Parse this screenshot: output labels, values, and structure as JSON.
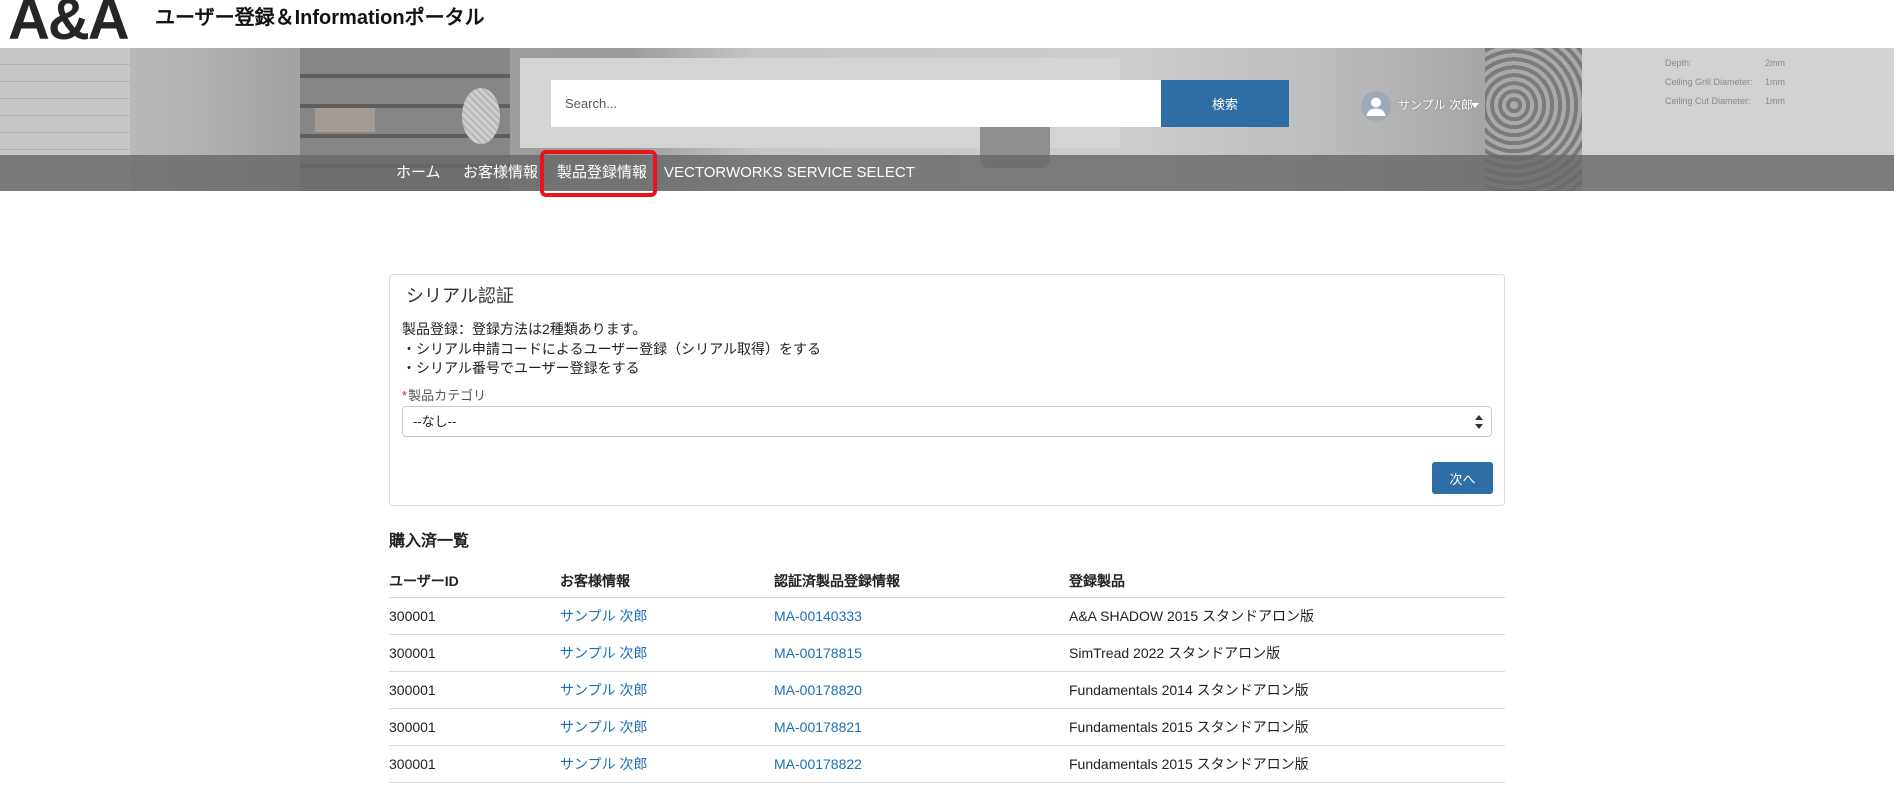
{
  "header": {
    "logo_text": "A&A",
    "portal_title": "ユーザー登録＆Informationポータル"
  },
  "search": {
    "placeholder": "Search...",
    "value": "",
    "button_label": "検索",
    "icon": "search-icon"
  },
  "user_menu": {
    "name": "サンプル 次郎",
    "avatar_icon": "user-avatar-icon",
    "caret_icon": "caret-down-icon"
  },
  "banner": {
    "background_text": [
      {
        "label": "Depth:",
        "value": "2mm"
      },
      {
        "label": "Ceiling Grill Diameter:",
        "value": "1mm"
      },
      {
        "label": "Ceiling Cut Diameter:",
        "value": "1mm"
      }
    ]
  },
  "nav": {
    "items": [
      {
        "label": "ホーム",
        "highlighted": false
      },
      {
        "label": "お客様情報",
        "highlighted": false
      },
      {
        "label": "製品登録情報",
        "highlighted": true
      },
      {
        "label": "VECTORWORKS SERVICE SELECT",
        "highlighted": false
      }
    ],
    "highlight_color": "#e8141b"
  },
  "serial_card": {
    "title": "シリアル認証",
    "description_lines": [
      "製品登録：登録方法は2種類あります。",
      "・シリアル申請コードによるユーザー登録（シリアル取得）をする",
      "・シリアル番号でユーザー登録をする"
    ],
    "category_field": {
      "required_mark": "*",
      "label": "製品カテゴリ",
      "selected": "--なし--"
    },
    "next_button": "次へ"
  },
  "purchases": {
    "title": "購入済一覧",
    "columns": [
      "ユーザーID",
      "お客様情報",
      "認証済製品登録情報",
      "登録製品"
    ],
    "rows": [
      {
        "user_id": "300001",
        "customer": "サンプル 次郎",
        "registration_no": "MA-00140333",
        "product": "A&A SHADOW 2015 スタンドアロン版"
      },
      {
        "user_id": "300001",
        "customer": "サンプル 次郎",
        "registration_no": "MA-00178815",
        "product": "SimTread 2022 スタンドアロン版"
      },
      {
        "user_id": "300001",
        "customer": "サンプル 次郎",
        "registration_no": "MA-00178820",
        "product": "Fundamentals 2014 スタンドアロン版"
      },
      {
        "user_id": "300001",
        "customer": "サンプル 次郎",
        "registration_no": "MA-00178821",
        "product": "Fundamentals 2015 スタンドアロン版"
      },
      {
        "user_id": "300001",
        "customer": "サンプル 次郎",
        "registration_no": "MA-00178822",
        "product": "Fundamentals 2015 スタンドアロン版"
      }
    ]
  },
  "colors": {
    "primary_button": "#2d6ea7",
    "link": "#1b6fb5",
    "nav_bar": "#6f6f6f",
    "required": "#c23934"
  }
}
